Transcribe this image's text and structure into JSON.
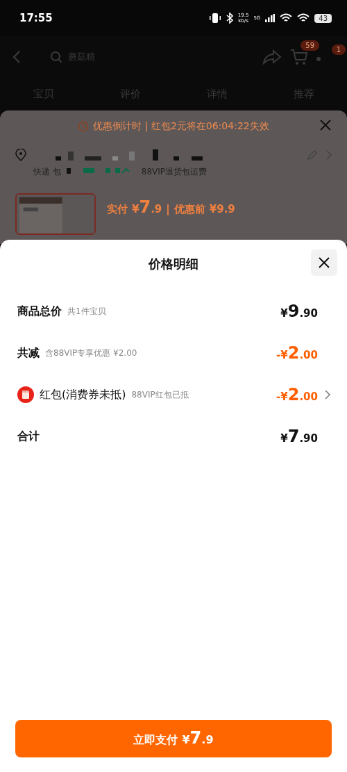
{
  "status_bar": {
    "time": "17:55",
    "net_speed": "19.5",
    "net_unit": "kb/s",
    "network": "5G",
    "battery": "43"
  },
  "header": {
    "search": {
      "value": "蘑菇精"
    },
    "cart_badge": "59",
    "message_badge": "1"
  },
  "tabs": [
    {
      "label": "宝贝"
    },
    {
      "label": "评价"
    },
    {
      "label": "详情"
    },
    {
      "label": "推荐"
    }
  ],
  "order_sheet": {
    "countdown": "优惠倒计时 | 红包2元将在06:04:22失效",
    "shipping": "快递 包",
    "shipping_note": "88VIP退货包运费",
    "paid_label": "实付",
    "paid_price": {
      "symbol": "¥",
      "integer": "7",
      "decimals": ".9"
    },
    "separator": "|",
    "original_label": "优惠前",
    "original_price": "¥9.9"
  },
  "price_detail": {
    "title": "价格明细",
    "rows": [
      {
        "kind": "plain",
        "label": "商品总价",
        "note": "共1件宝贝",
        "amount": {
          "symbol": "¥",
          "integer": "9",
          "decimals": ".90"
        }
      },
      {
        "kind": "discount",
        "label": "共减",
        "note": "含88VIP专享优惠 ¥2.00",
        "amount": {
          "sign": "-",
          "symbol": "¥",
          "integer": "2",
          "decimals": ".00"
        }
      },
      {
        "kind": "coupon",
        "label": "红包(消费券未抵)",
        "note": "88VIP红包已抵",
        "amount": {
          "sign": "-",
          "symbol": "¥",
          "integer": "2",
          "decimals": ".00"
        }
      },
      {
        "kind": "plain",
        "label": "合计",
        "amount": {
          "symbol": "¥",
          "integer": "7",
          "decimals": ".90"
        }
      }
    ]
  },
  "pay_button": {
    "label": "立即支付",
    "price": {
      "symbol": "¥",
      "integer": "7",
      "decimals": ".9"
    }
  }
}
